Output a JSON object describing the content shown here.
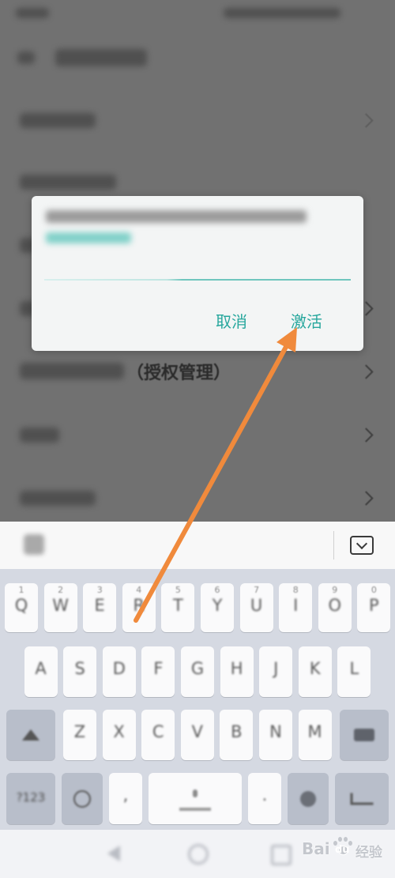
{
  "colors": {
    "accent_teal": "#27a79d",
    "arrow_orange": "#f08a3c",
    "overlay_gray": "#717171",
    "keyboard_bg": "#d5d9e2"
  },
  "settings_list": {
    "third_party_suffix": "（授权管理）"
  },
  "dialog": {
    "cancel_label": "取消",
    "activate_label": "激活"
  },
  "keyboard": {
    "row1": [
      {
        "letter": "Q",
        "number": "1"
      },
      {
        "letter": "W",
        "number": "2"
      },
      {
        "letter": "E",
        "number": "3"
      },
      {
        "letter": "R",
        "number": "4"
      },
      {
        "letter": "T",
        "number": "5"
      },
      {
        "letter": "Y",
        "number": "6"
      },
      {
        "letter": "U",
        "number": "7"
      },
      {
        "letter": "I",
        "number": "8"
      },
      {
        "letter": "O",
        "number": "9"
      },
      {
        "letter": "P",
        "number": "0"
      }
    ],
    "row2": [
      "A",
      "S",
      "D",
      "F",
      "G",
      "H",
      "J",
      "K",
      "L"
    ],
    "row3": [
      "Z",
      "X",
      "C",
      "V",
      "B",
      "N",
      "M"
    ],
    "symbols_label": "?123",
    "comma": ",",
    "period": "."
  },
  "icons": {
    "header": "back-arrow-icon",
    "list_row": "chevron-right-icon",
    "keyboard_bar_left": "emoji-icon",
    "keyboard_bar_right": "keyboard-hide-icon",
    "nav": [
      "nav-back-icon",
      "nav-home-icon",
      "nav-recents-icon"
    ]
  },
  "watermark": {
    "brand_left": "Bai",
    "brand_right": "du",
    "product": "经验"
  }
}
